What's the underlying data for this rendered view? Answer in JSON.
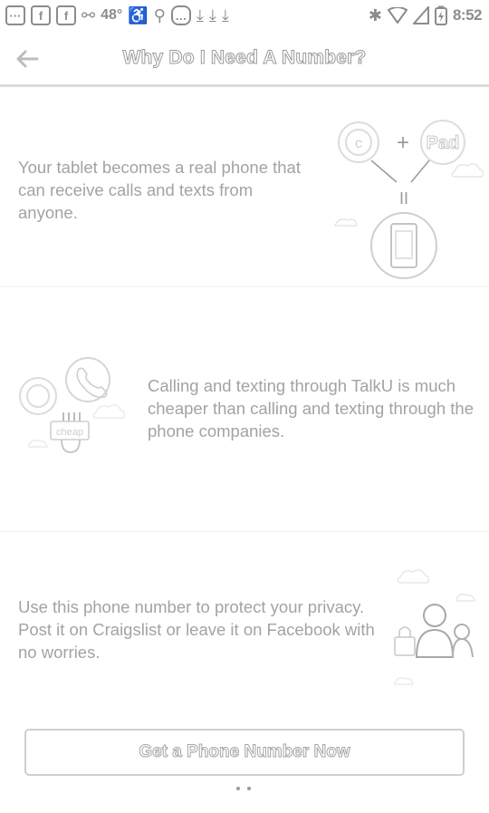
{
  "status_bar": {
    "left_icons": [
      "chat-icon",
      "facebook-icon",
      "facebook-icon",
      "wrench-icon",
      "temperature-icon",
      "accessibility-icon",
      "search-icon",
      "messenger-icon",
      "download-icon",
      "download-icon",
      "download-icon"
    ],
    "facebook_glyph": "f",
    "temperature": "48°",
    "time": "8:52"
  },
  "header": {
    "title": "Why Do I Need A Number?"
  },
  "sections": [
    {
      "text": "Your tablet becomes a real phone that can receive calls and texts from anyone.",
      "illustration": {
        "plus": "+",
        "pad_label": "Pad",
        "equals": "II"
      }
    },
    {
      "text": "Calling and texting through TalkU is much cheaper than calling and texting through the phone companies.",
      "illustration": {
        "tag_label": "cheap"
      }
    },
    {
      "text": "Use this phone number to protect your privacy. Post it on Craigslist or leave it on Facebook with no worries."
    }
  ],
  "cta": {
    "label": "Get a Phone Number Now"
  },
  "colors": {
    "text": "#a3a3a3",
    "line": "#cfcfcf",
    "background": "#ffffff"
  }
}
